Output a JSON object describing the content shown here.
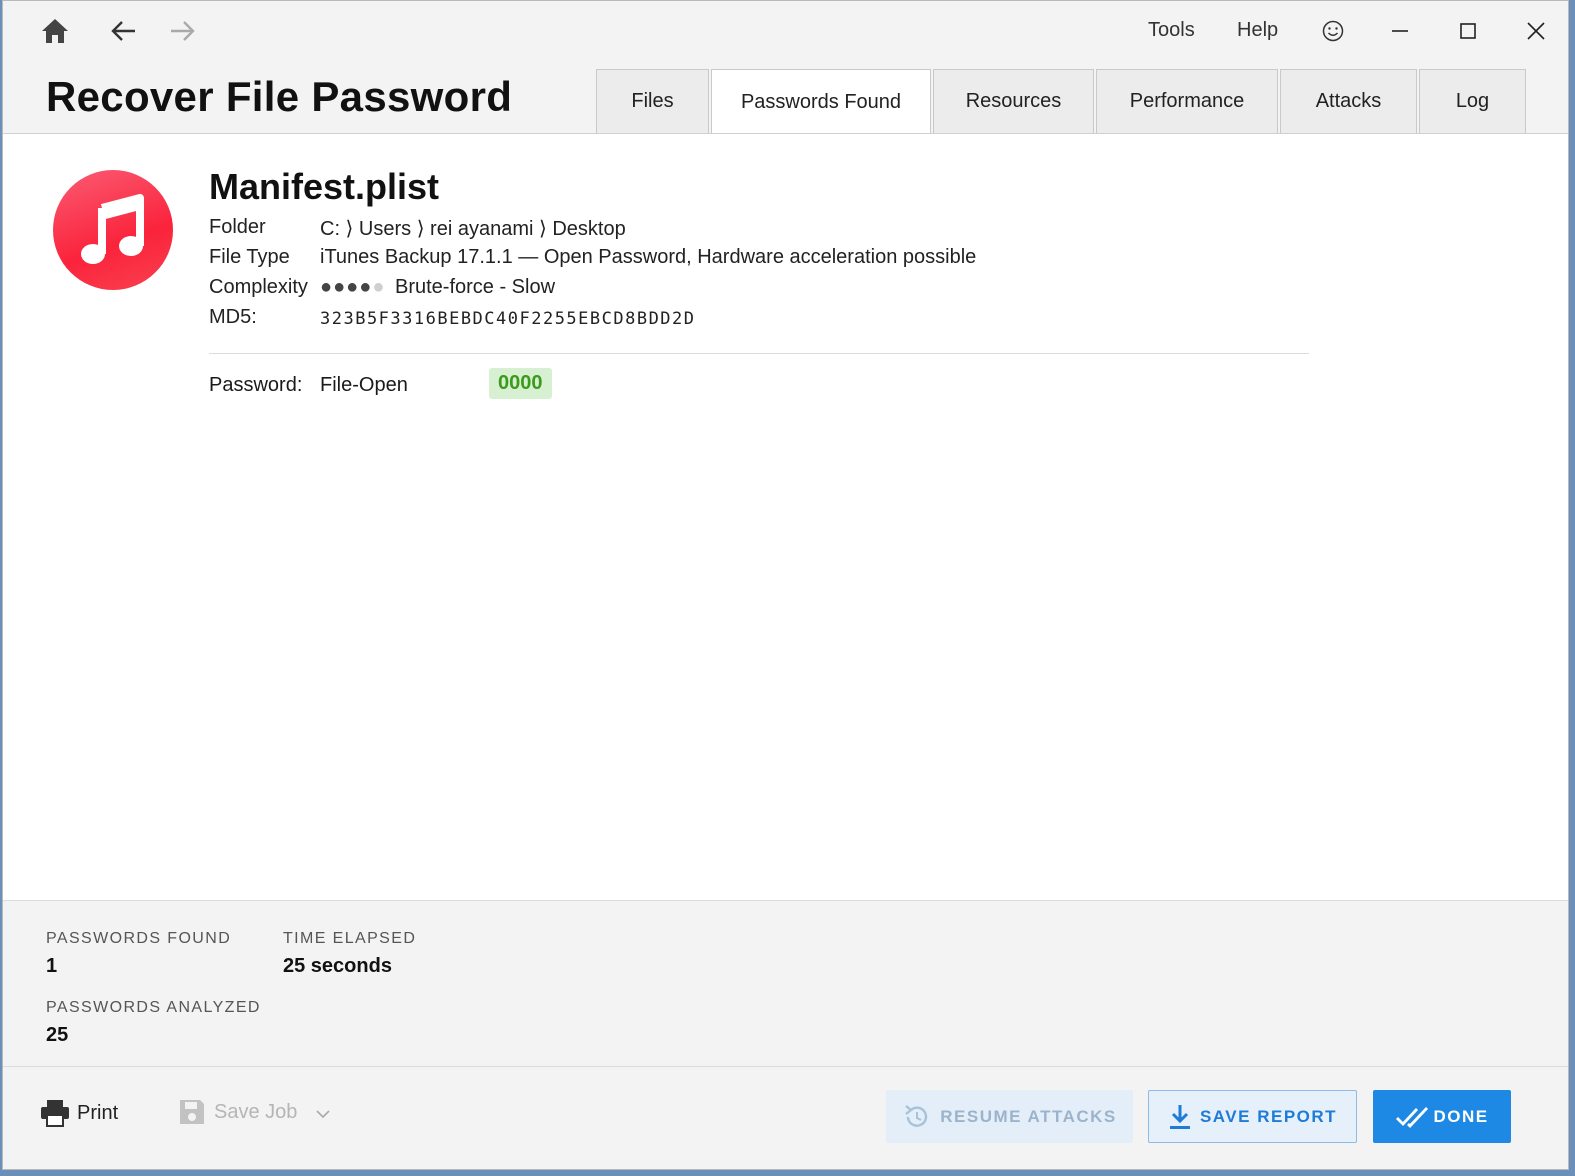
{
  "titlebar": {
    "menu_tools": "Tools",
    "menu_help": "Help"
  },
  "header": {
    "title": "Recover File Password"
  },
  "tabs": [
    {
      "label": "Files",
      "active": false
    },
    {
      "label": "Passwords Found",
      "active": true
    },
    {
      "label": "Resources",
      "active": false
    },
    {
      "label": "Performance",
      "active": false
    },
    {
      "label": "Attacks",
      "active": false
    },
    {
      "label": "Log",
      "active": false
    }
  ],
  "file": {
    "name": "Manifest.plist",
    "icon": "music-note-icon",
    "icon_color": "#fa233b",
    "folder_label": "Folder",
    "folder_value": "C: ⟩ Users ⟩ rei ayanami ⟩ Desktop",
    "type_label": "File Type",
    "type_value": "iTunes Backup 17.1.1 — Open Password, Hardware acceleration possible",
    "complexity_label": "Complexity",
    "complexity_level": 4,
    "complexity_max": 5,
    "complexity_value": "Brute-force - Slow",
    "md5_label": "MD5:",
    "md5_value": "323B5F3316BEBDC40F2255EBCD8BDD2D"
  },
  "password": {
    "label": "Password:",
    "kind": "File-Open",
    "value": "0000"
  },
  "stats": {
    "found_label": "PASSWORDS FOUND",
    "found_value": "1",
    "elapsed_label": "TIME ELAPSED",
    "elapsed_value": "25 seconds",
    "analyzed_label": "PASSWORDS ANALYZED",
    "analyzed_value": "25"
  },
  "footer": {
    "print_label": "Print",
    "save_job_label": "Save Job",
    "resume_label": "RESUME ATTACKS",
    "save_report_label": "SAVE REPORT",
    "done_label": "DONE"
  },
  "colors": {
    "accent": "#1e88e5",
    "password_badge_bg": "#d8f0d2",
    "password_badge_text": "#3a9b1c"
  }
}
